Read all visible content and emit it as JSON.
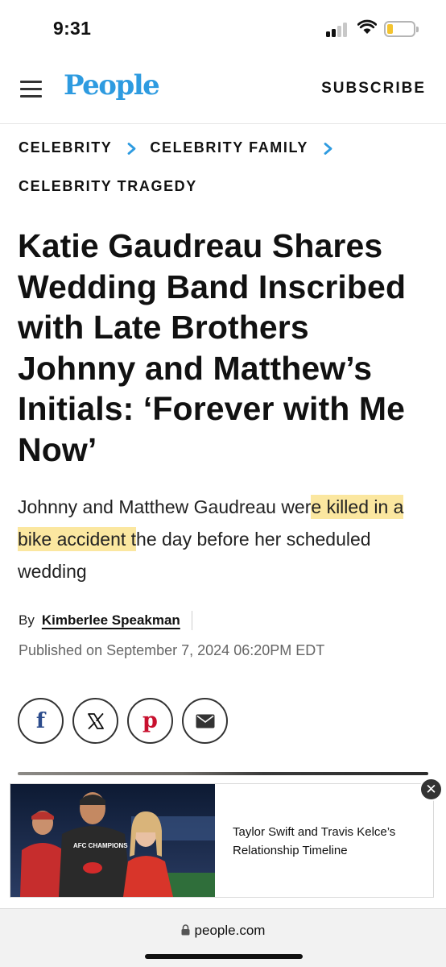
{
  "status_bar": {
    "time": "9:31"
  },
  "header": {
    "logo": "People",
    "subscribe_label": "SUBSCRIBE"
  },
  "breadcrumb": [
    "CELEBRITY",
    "CELEBRITY FAMILY",
    "CELEBRITY TRAGEDY"
  ],
  "article": {
    "headline": "Katie Gaudreau Shares Wedding Band Inscribed with Late Brothers Johnny and Matthew’s Initials: ‘Forever with Me Now’",
    "deck_before": "Johnny and Matthew Gaudreau wer",
    "deck_highlight": "e killed in a bike accident t",
    "deck_after": "he day before her scheduled wedding",
    "by_label": "By",
    "author": "Kimberlee Speakman",
    "published": "Published on September 7, 2024 06:20PM EDT"
  },
  "share": [
    "facebook-icon",
    "x-icon",
    "pinterest-icon",
    "email-icon"
  ],
  "ad": {
    "title": "Taylor Swift and Travis Kelce’s Relationship Timeline",
    "photo_text": "AFC CHAMPIONS"
  },
  "browser": {
    "url": "people.com"
  },
  "colors": {
    "logo": "#2e9be0",
    "chevron": "#2e9be0",
    "highlight": "#fbe7a0",
    "pinterest": "#c8102e",
    "facebook": "#2c4c8c"
  }
}
